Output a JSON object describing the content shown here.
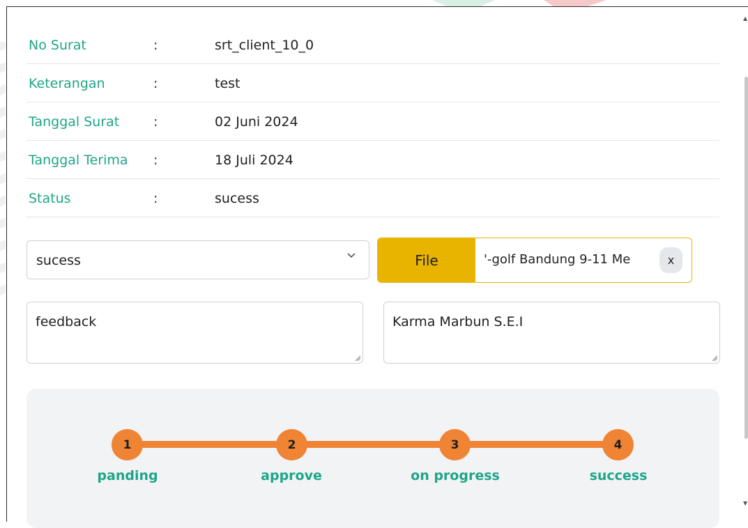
{
  "details": [
    {
      "label": "No Surat",
      "colon": ":",
      "value": "srt_client_10_0"
    },
    {
      "label": "Keterangan",
      "colon": ":",
      "value": "test"
    },
    {
      "label": "Tanggal Surat",
      "colon": ":",
      "value": "02 Juni 2024"
    },
    {
      "label": "Tanggal Terima",
      "colon": ":",
      "value": "18 Juli 2024"
    },
    {
      "label": "Status",
      "colon": ":",
      "value": "sucess"
    }
  ],
  "status_select": {
    "selected": "sucess",
    "icon": "chevron-down-icon"
  },
  "file_input": {
    "button_label": "File",
    "file_name": "'-golf Bandung 9-11 Me",
    "clear_label": "x"
  },
  "feedback_field": {
    "value": "feedback"
  },
  "name_field": {
    "value": "Karma Marbun S.E.I"
  },
  "progress": {
    "steps": [
      {
        "number": "1",
        "label": "panding"
      },
      {
        "number": "2",
        "label": "approve"
      },
      {
        "number": "3",
        "label": "on progress"
      },
      {
        "number": "4",
        "label": "success"
      }
    ],
    "color": "#ee8434",
    "label_color": "#1fa589"
  },
  "colors": {
    "accent_green": "#1fa589",
    "file_button": "#e9b400"
  }
}
